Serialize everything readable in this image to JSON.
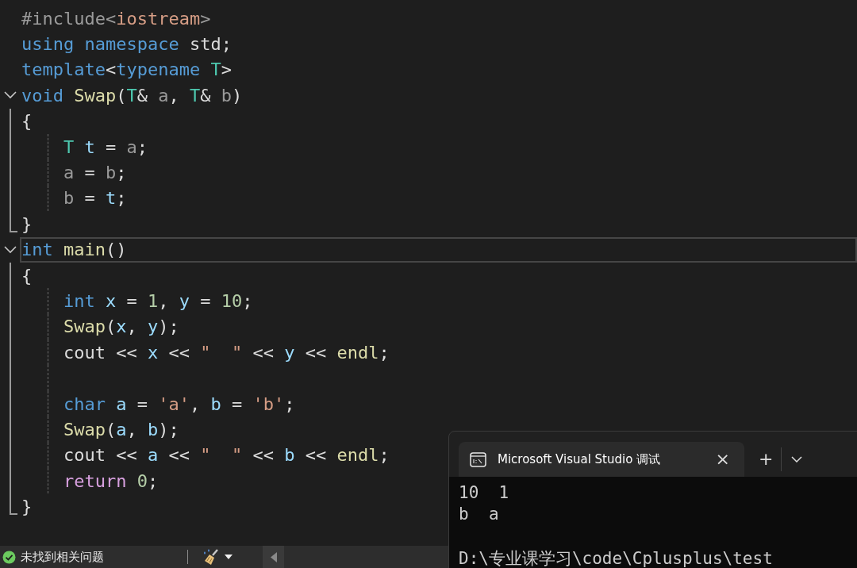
{
  "editor": {
    "lines": [
      {
        "kind": "plain",
        "tokens": [
          {
            "kind": "pre",
            "text": "#include<"
          },
          {
            "kind": "str",
            "text": "iostream"
          },
          {
            "kind": "pre",
            "text": ">"
          }
        ]
      },
      {
        "kind": "plain",
        "tokens": [
          {
            "kind": "kw",
            "text": "using"
          },
          {
            "kind": "kw",
            "text": " namespace"
          },
          {
            "kind": "plain",
            "text": " std;"
          }
        ]
      },
      {
        "kind": "plain",
        "tokens": [
          {
            "kind": "kw",
            "text": "template"
          },
          {
            "kind": "plain",
            "text": "<"
          },
          {
            "kind": "kw",
            "text": "typename"
          },
          {
            "kind": "type",
            "text": " T"
          },
          {
            "kind": "plain",
            "text": ">"
          }
        ]
      },
      {
        "kind": "fold_start",
        "expanded": true,
        "tokens": [
          {
            "kind": "kw",
            "text": "void"
          },
          {
            "kind": "fn",
            "text": " Swap"
          },
          {
            "kind": "plain",
            "text": "("
          },
          {
            "kind": "type",
            "text": "T"
          },
          {
            "kind": "plain",
            "text": "& "
          },
          {
            "kind": "param",
            "text": "a"
          },
          {
            "kind": "plain",
            "text": ", "
          },
          {
            "kind": "type",
            "text": "T"
          },
          {
            "kind": "plain",
            "text": "& "
          },
          {
            "kind": "param",
            "text": "b"
          },
          {
            "kind": "plain",
            "text": ")"
          }
        ]
      },
      {
        "kind": "fold_body",
        "tokens": [
          {
            "kind": "plain",
            "text": "{"
          }
        ]
      },
      {
        "kind": "fold_body",
        "indent": true,
        "tokens": [
          {
            "kind": "type",
            "text": "T"
          },
          {
            "kind": "var",
            "text": " t"
          },
          {
            "kind": "plain",
            "text": " = "
          },
          {
            "kind": "param",
            "text": "a"
          },
          {
            "kind": "plain",
            "text": ";"
          }
        ]
      },
      {
        "kind": "fold_body",
        "indent": true,
        "tokens": [
          {
            "kind": "param",
            "text": "a"
          },
          {
            "kind": "plain",
            "text": " = "
          },
          {
            "kind": "param",
            "text": "b"
          },
          {
            "kind": "plain",
            "text": ";"
          }
        ]
      },
      {
        "kind": "fold_body",
        "indent": true,
        "tokens": [
          {
            "kind": "param",
            "text": "b"
          },
          {
            "kind": "plain",
            "text": " = "
          },
          {
            "kind": "var",
            "text": "t"
          },
          {
            "kind": "plain",
            "text": ";"
          }
        ]
      },
      {
        "kind": "fold_end",
        "tokens": [
          {
            "kind": "plain",
            "text": "}"
          }
        ]
      },
      {
        "kind": "fold_start",
        "expanded": true,
        "current": true,
        "tokens": [
          {
            "kind": "kw",
            "text": "int"
          },
          {
            "kind": "fn",
            "text": " main"
          },
          {
            "kind": "plain",
            "text": "()"
          }
        ]
      },
      {
        "kind": "fold_body",
        "tokens": [
          {
            "kind": "plain",
            "text": "{"
          }
        ]
      },
      {
        "kind": "fold_body",
        "indent": true,
        "tokens": [
          {
            "kind": "kw",
            "text": "int"
          },
          {
            "kind": "var",
            "text": " x"
          },
          {
            "kind": "plain",
            "text": " = "
          },
          {
            "kind": "num",
            "text": "1"
          },
          {
            "kind": "plain",
            "text": ", "
          },
          {
            "kind": "var",
            "text": "y"
          },
          {
            "kind": "plain",
            "text": " = "
          },
          {
            "kind": "num",
            "text": "10"
          },
          {
            "kind": "plain",
            "text": ";"
          }
        ]
      },
      {
        "kind": "fold_body",
        "indent": true,
        "tokens": [
          {
            "kind": "fn",
            "text": "Swap"
          },
          {
            "kind": "plain",
            "text": "("
          },
          {
            "kind": "var",
            "text": "x"
          },
          {
            "kind": "plain",
            "text": ", "
          },
          {
            "kind": "var",
            "text": "y"
          },
          {
            "kind": "plain",
            "text": ");"
          }
        ]
      },
      {
        "kind": "fold_body",
        "indent": true,
        "tokens": [
          {
            "kind": "plain",
            "text": "cout << "
          },
          {
            "kind": "var",
            "text": "x"
          },
          {
            "kind": "plain",
            "text": " << "
          },
          {
            "kind": "str",
            "text": "\"  \""
          },
          {
            "kind": "plain",
            "text": " << "
          },
          {
            "kind": "var",
            "text": "y"
          },
          {
            "kind": "plain",
            "text": " << "
          },
          {
            "kind": "fn",
            "text": "endl"
          },
          {
            "kind": "plain",
            "text": ";"
          }
        ]
      },
      {
        "kind": "fold_body",
        "indent": true
      },
      {
        "kind": "fold_body",
        "indent": true,
        "tokens": [
          {
            "kind": "kw",
            "text": "char"
          },
          {
            "kind": "var",
            "text": " a"
          },
          {
            "kind": "plain",
            "text": " = "
          },
          {
            "kind": "str",
            "text": "'a'"
          },
          {
            "kind": "plain",
            "text": ", "
          },
          {
            "kind": "var",
            "text": "b"
          },
          {
            "kind": "plain",
            "text": " = "
          },
          {
            "kind": "str",
            "text": "'b'"
          },
          {
            "kind": "plain",
            "text": ";"
          }
        ]
      },
      {
        "kind": "fold_body",
        "indent": true,
        "tokens": [
          {
            "kind": "fn",
            "text": "Swap"
          },
          {
            "kind": "plain",
            "text": "("
          },
          {
            "kind": "var",
            "text": "a"
          },
          {
            "kind": "plain",
            "text": ", "
          },
          {
            "kind": "var",
            "text": "b"
          },
          {
            "kind": "plain",
            "text": ");"
          }
        ]
      },
      {
        "kind": "fold_body",
        "indent": true,
        "tokens": [
          {
            "kind": "plain",
            "text": "cout << "
          },
          {
            "kind": "var",
            "text": "a"
          },
          {
            "kind": "plain",
            "text": " << "
          },
          {
            "kind": "str",
            "text": "\"  \""
          },
          {
            "kind": "plain",
            "text": " << "
          },
          {
            "kind": "var",
            "text": "b"
          },
          {
            "kind": "plain",
            "text": " << "
          },
          {
            "kind": "fn",
            "text": "endl"
          },
          {
            "kind": "plain",
            "text": ";"
          }
        ]
      },
      {
        "kind": "fold_body",
        "indent": true,
        "tokens": [
          {
            "kind": "ctl",
            "text": "return"
          },
          {
            "kind": "num",
            "text": " 0"
          },
          {
            "kind": "plain",
            "text": ";"
          }
        ]
      },
      {
        "kind": "fold_end",
        "tokens": [
          {
            "kind": "plain",
            "text": "}"
          }
        ]
      }
    ]
  },
  "status_bar": {
    "message": "未找到相关问题"
  },
  "terminal": {
    "tab_title": "Microsoft Visual Studio 调试",
    "close": "×",
    "new_tab": "+",
    "output": [
      [
        "10  1",
        "b  a"
      ],
      [
        "D:\\专业课学习\\code\\Cplusplus\\test"
      ]
    ]
  }
}
